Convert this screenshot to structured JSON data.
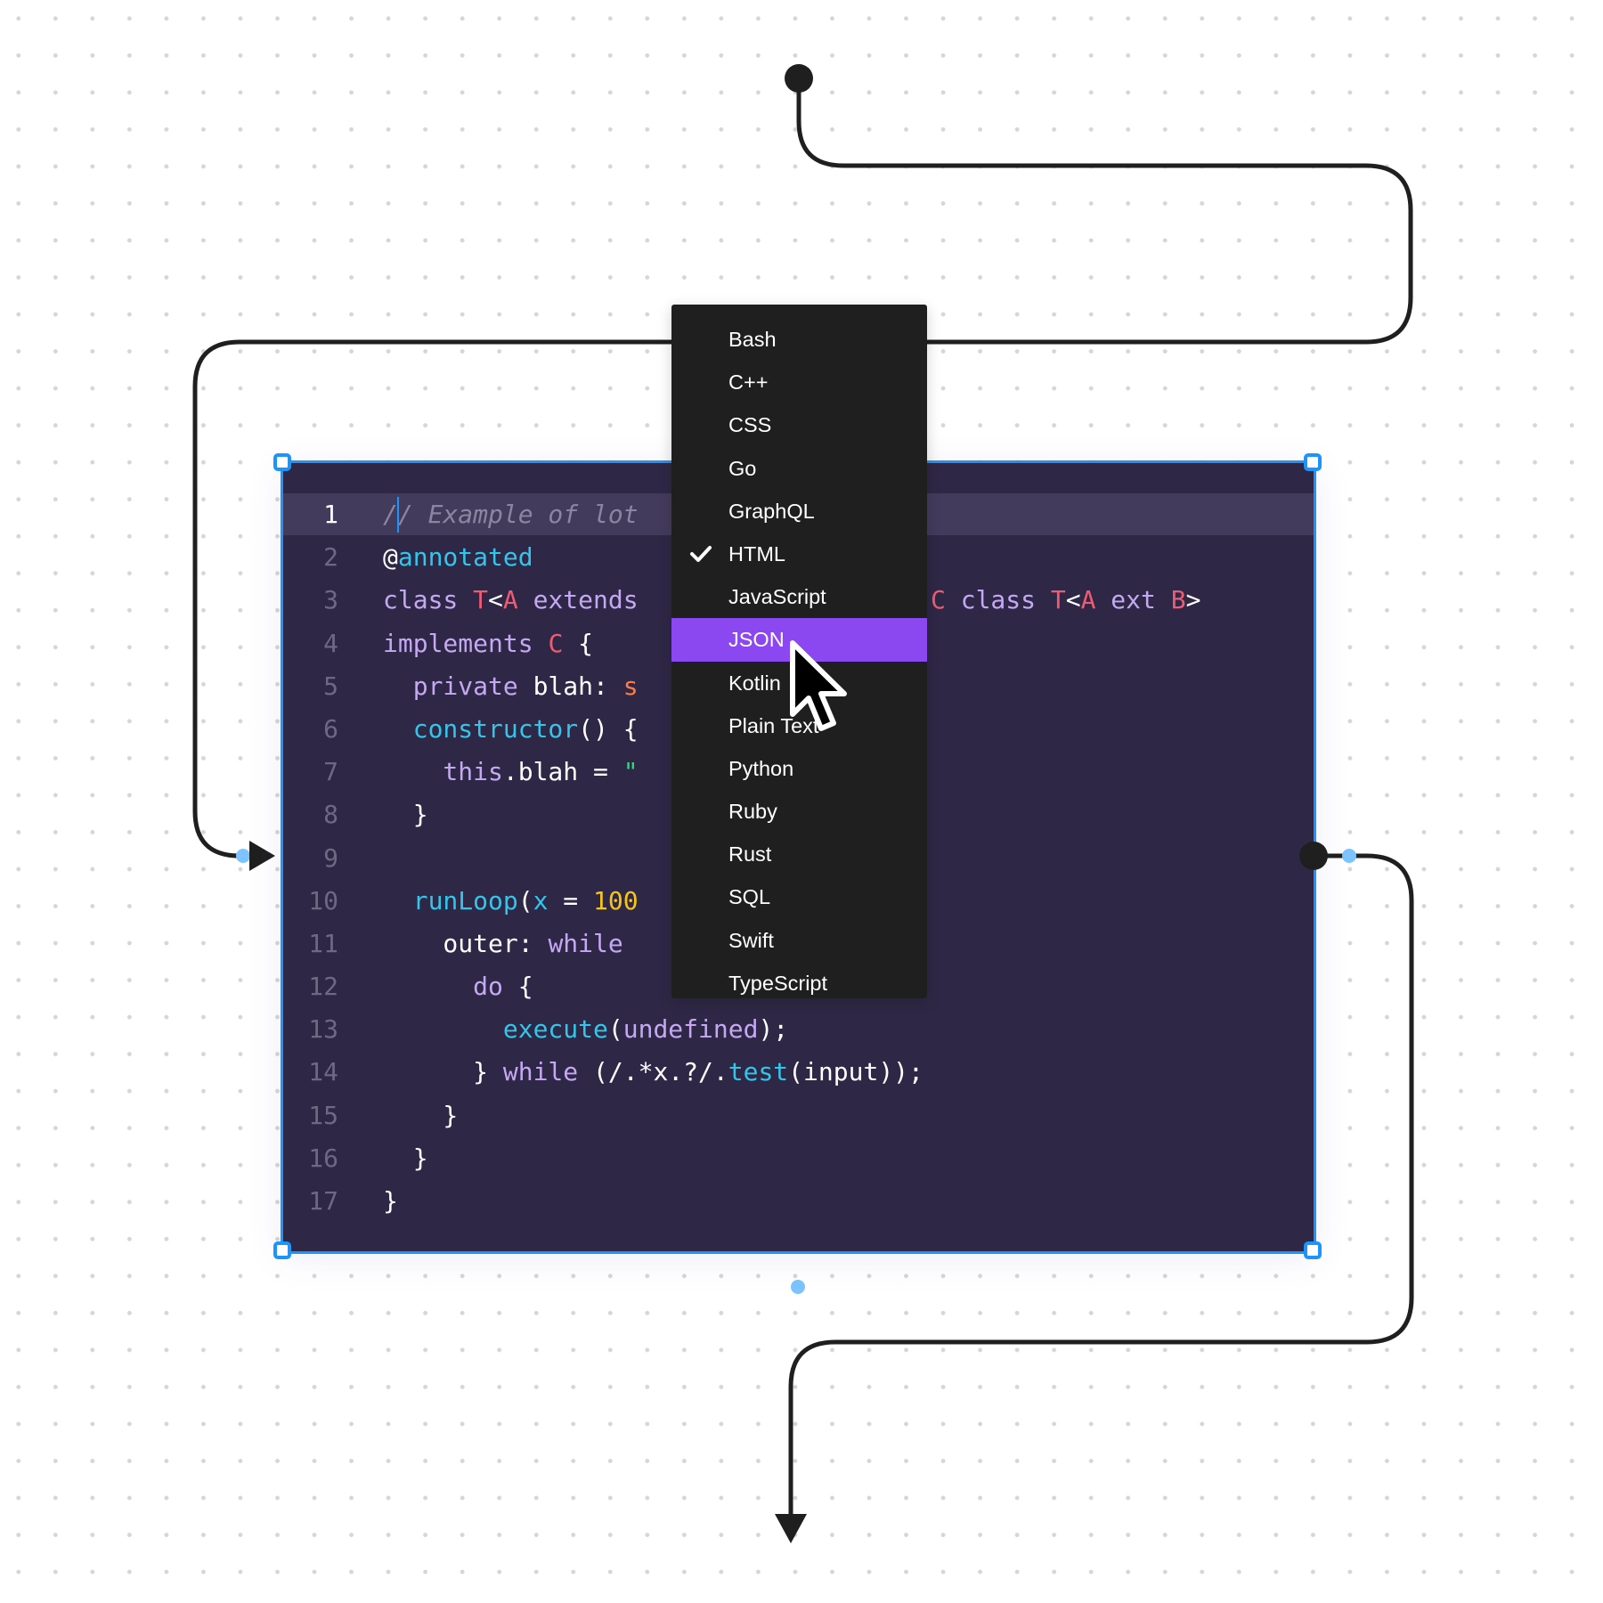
{
  "code_block": {
    "active_line": 1,
    "lines": [
      {
        "n": "1",
        "tokens": [
          {
            "t": "// Example of lot",
            "c": "comment"
          }
        ]
      },
      {
        "n": "2",
        "tokens": [
          {
            "t": "@",
            "c": "plain"
          },
          {
            "t": "annotated",
            "c": "fn"
          }
        ]
      },
      {
        "n": "3",
        "tokens": [
          {
            "t": "class ",
            "c": "kw"
          },
          {
            "t": "T",
            "c": "type"
          },
          {
            "t": "<",
            "c": "plain"
          },
          {
            "t": "A",
            "c": "type"
          },
          {
            "t": " extends",
            "c": "kw"
          }
        ]
      },
      {
        "n": "4",
        "tokens": [
          {
            "t": "implements ",
            "c": "kw"
          },
          {
            "t": "C",
            "c": "type"
          },
          {
            "t": " {",
            "c": "plain"
          }
        ]
      },
      {
        "n": "5",
        "tokens": [
          {
            "t": "  private ",
            "c": "kw"
          },
          {
            "t": "blah: ",
            "c": "plain"
          },
          {
            "t": "s",
            "c": "orange"
          }
        ]
      },
      {
        "n": "6",
        "tokens": [
          {
            "t": "  constructor",
            "c": "fn"
          },
          {
            "t": "() {",
            "c": "plain"
          }
        ]
      },
      {
        "n": "7",
        "tokens": [
          {
            "t": "    this",
            "c": "kw"
          },
          {
            "t": ".blah = ",
            "c": "plain"
          },
          {
            "t": "\"",
            "c": "str"
          }
        ]
      },
      {
        "n": "8",
        "tokens": [
          {
            "t": "  }",
            "c": "plain"
          }
        ]
      },
      {
        "n": "9",
        "tokens": []
      },
      {
        "n": "10",
        "tokens": [
          {
            "t": "  runLoop",
            "c": "fn"
          },
          {
            "t": "(",
            "c": "plain"
          },
          {
            "t": "x",
            "c": "fn"
          },
          {
            "t": " = ",
            "c": "plain"
          },
          {
            "t": "100",
            "c": "num"
          }
        ]
      },
      {
        "n": "11",
        "tokens": [
          {
            "t": "    outer: ",
            "c": "plain"
          },
          {
            "t": "while",
            "c": "kw"
          }
        ]
      },
      {
        "n": "12",
        "tokens": [
          {
            "t": "      do",
            "c": "kw"
          },
          {
            "t": " {",
            "c": "plain"
          }
        ]
      },
      {
        "n": "13",
        "tokens": [
          {
            "t": "        execute",
            "c": "fn"
          },
          {
            "t": "(",
            "c": "plain"
          },
          {
            "t": "undefined",
            "c": "kw"
          },
          {
            "t": ");",
            "c": "plain"
          }
        ]
      },
      {
        "n": "14",
        "tokens": [
          {
            "t": "      } ",
            "c": "plain"
          },
          {
            "t": "while",
            "c": "kw"
          },
          {
            "t": " (/.*x.?/.",
            "c": "plain"
          },
          {
            "t": "test",
            "c": "fn"
          },
          {
            "t": "(input));",
            "c": "plain"
          }
        ]
      },
      {
        "n": "15",
        "tokens": [
          {
            "t": "    }",
            "c": "plain"
          }
        ]
      },
      {
        "n": "16",
        "tokens": [
          {
            "t": "  }",
            "c": "plain"
          }
        ]
      },
      {
        "n": "17",
        "tokens": [
          {
            "t": "}",
            "c": "plain"
          }
        ]
      }
    ],
    "overflow_line3_visible_tail": [
      {
        "t": "C",
        "c": "type"
      },
      {
        "t": " class ",
        "c": "kw"
      },
      {
        "t": "T",
        "c": "type"
      },
      {
        "t": "<",
        "c": "plain"
      },
      {
        "t": "A",
        "c": "type"
      },
      {
        "t": " ext ",
        "c": "kw"
      },
      {
        "t": "B",
        "c": "type"
      },
      {
        "t": ">",
        "c": "plain"
      }
    ]
  },
  "language_menu": {
    "selected": "HTML",
    "hovered": "JSON",
    "items": [
      "Bash",
      "C++",
      "CSS",
      "Go",
      "GraphQL",
      "HTML",
      "JavaScript",
      "JSON",
      "Kotlin",
      "Plain Text",
      "Python",
      "Ruby",
      "Rust",
      "SQL",
      "Swift",
      "TypeScript"
    ],
    "check_icon": "checkmark-icon"
  },
  "colors": {
    "selection": "#1a94ff",
    "menu_bg": "#1f1f1f",
    "menu_highlight": "#8b48f0",
    "code_bg": "#2e2846",
    "connector": "#1f1f1f",
    "connector_hint": "#7cc4ff"
  },
  "icons": {
    "cursor": "pointer-cursor-icon",
    "connector_start": "connector-endpoint-dot-icon",
    "arrowhead": "arrowhead-icon"
  }
}
